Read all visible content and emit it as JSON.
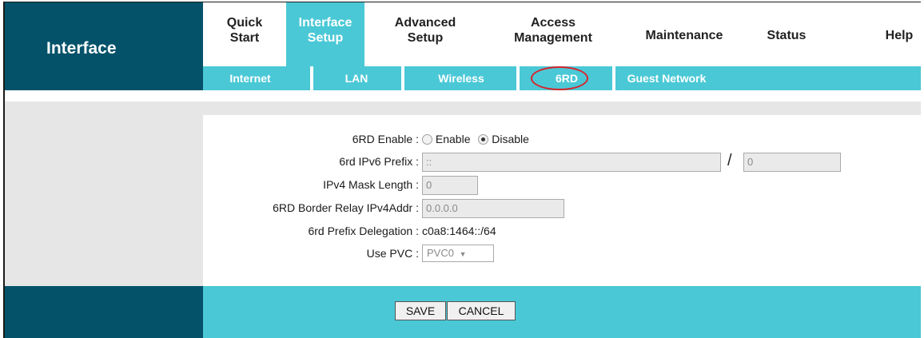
{
  "header": {
    "title": "Interface",
    "nav": [
      {
        "label_line1": "Quick",
        "label_line2": "Start"
      },
      {
        "label_line1": "Interface",
        "label_line2": "Setup"
      },
      {
        "label_line1": "Advanced",
        "label_line2": "Setup"
      },
      {
        "label_line1": "Access",
        "label_line2": "Management"
      },
      {
        "label": "Maintenance"
      },
      {
        "label": "Status"
      },
      {
        "label": "Help"
      }
    ],
    "subnav": [
      "Internet",
      "LAN",
      "Wireless",
      "6RD",
      "Guest Network"
    ],
    "active_nav": "Interface Setup",
    "active_subnav": "6RD"
  },
  "form": {
    "enable_label": "6RD Enable :",
    "enable_option": "Enable",
    "disable_option": "Disable",
    "enable_selected": "Disable",
    "prefix_label": "6rd IPv6 Prefix :",
    "prefix_value": "::",
    "prefix_separator": "/",
    "prefix_len_value": "0",
    "mask_label": "IPv4 Mask Length :",
    "mask_value": "0",
    "relay_label": "6RD Border Relay IPv4Addr :",
    "relay_value": "0.0.0.0",
    "delegation_label": "6rd Prefix Delegation :",
    "delegation_value": "c0a8:1464::/64",
    "pvc_label": "Use PVC :",
    "pvc_value": "PVC0",
    "pvc_arrow": "▼"
  },
  "footer": {
    "save_label": "SAVE",
    "cancel_label": "CANCEL"
  },
  "colors": {
    "dark_teal": "#04526a",
    "accent_cyan": "#4ac8d6",
    "highlight_ring": "#d8232a",
    "panel_gray": "#e6e6e6"
  }
}
